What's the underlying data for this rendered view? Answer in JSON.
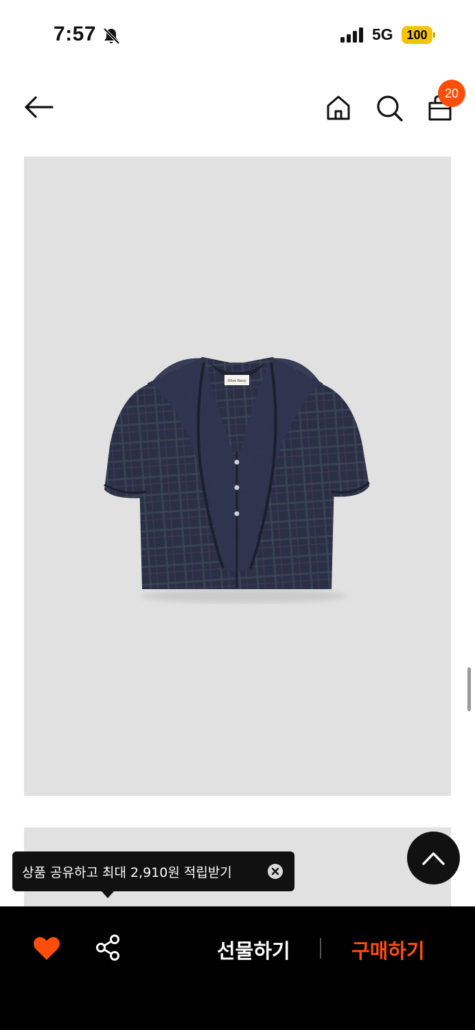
{
  "status_bar": {
    "time": "7:57",
    "network": "5G",
    "battery": "100",
    "icons": [
      "bell-slash-icon",
      "cellular-signal-icon",
      "battery-icon"
    ]
  },
  "header": {
    "icons": [
      "arrow-left-icon",
      "home-icon",
      "search-icon",
      "shopping-bag-icon"
    ],
    "cart_count": "20"
  },
  "product": {
    "label_text": "Olive Navy",
    "image_icon": "blouse-product-photo"
  },
  "tooltip": {
    "text": "상품 공유하고 최대 2,910원 적립받기",
    "close_icon": "close-circle-icon"
  },
  "scroll_top": {
    "icon": "chevron-up-icon"
  },
  "bottom_bar": {
    "like_icon": "heart-filled-icon",
    "share_icon": "share-icon",
    "gift_label": "선물하기",
    "buy_label": "구매하기"
  },
  "colors": {
    "accent": "#ff4e0a",
    "battery": "#f5c400",
    "image_background": "#e1e1e1",
    "garment": "#2a2f45"
  }
}
